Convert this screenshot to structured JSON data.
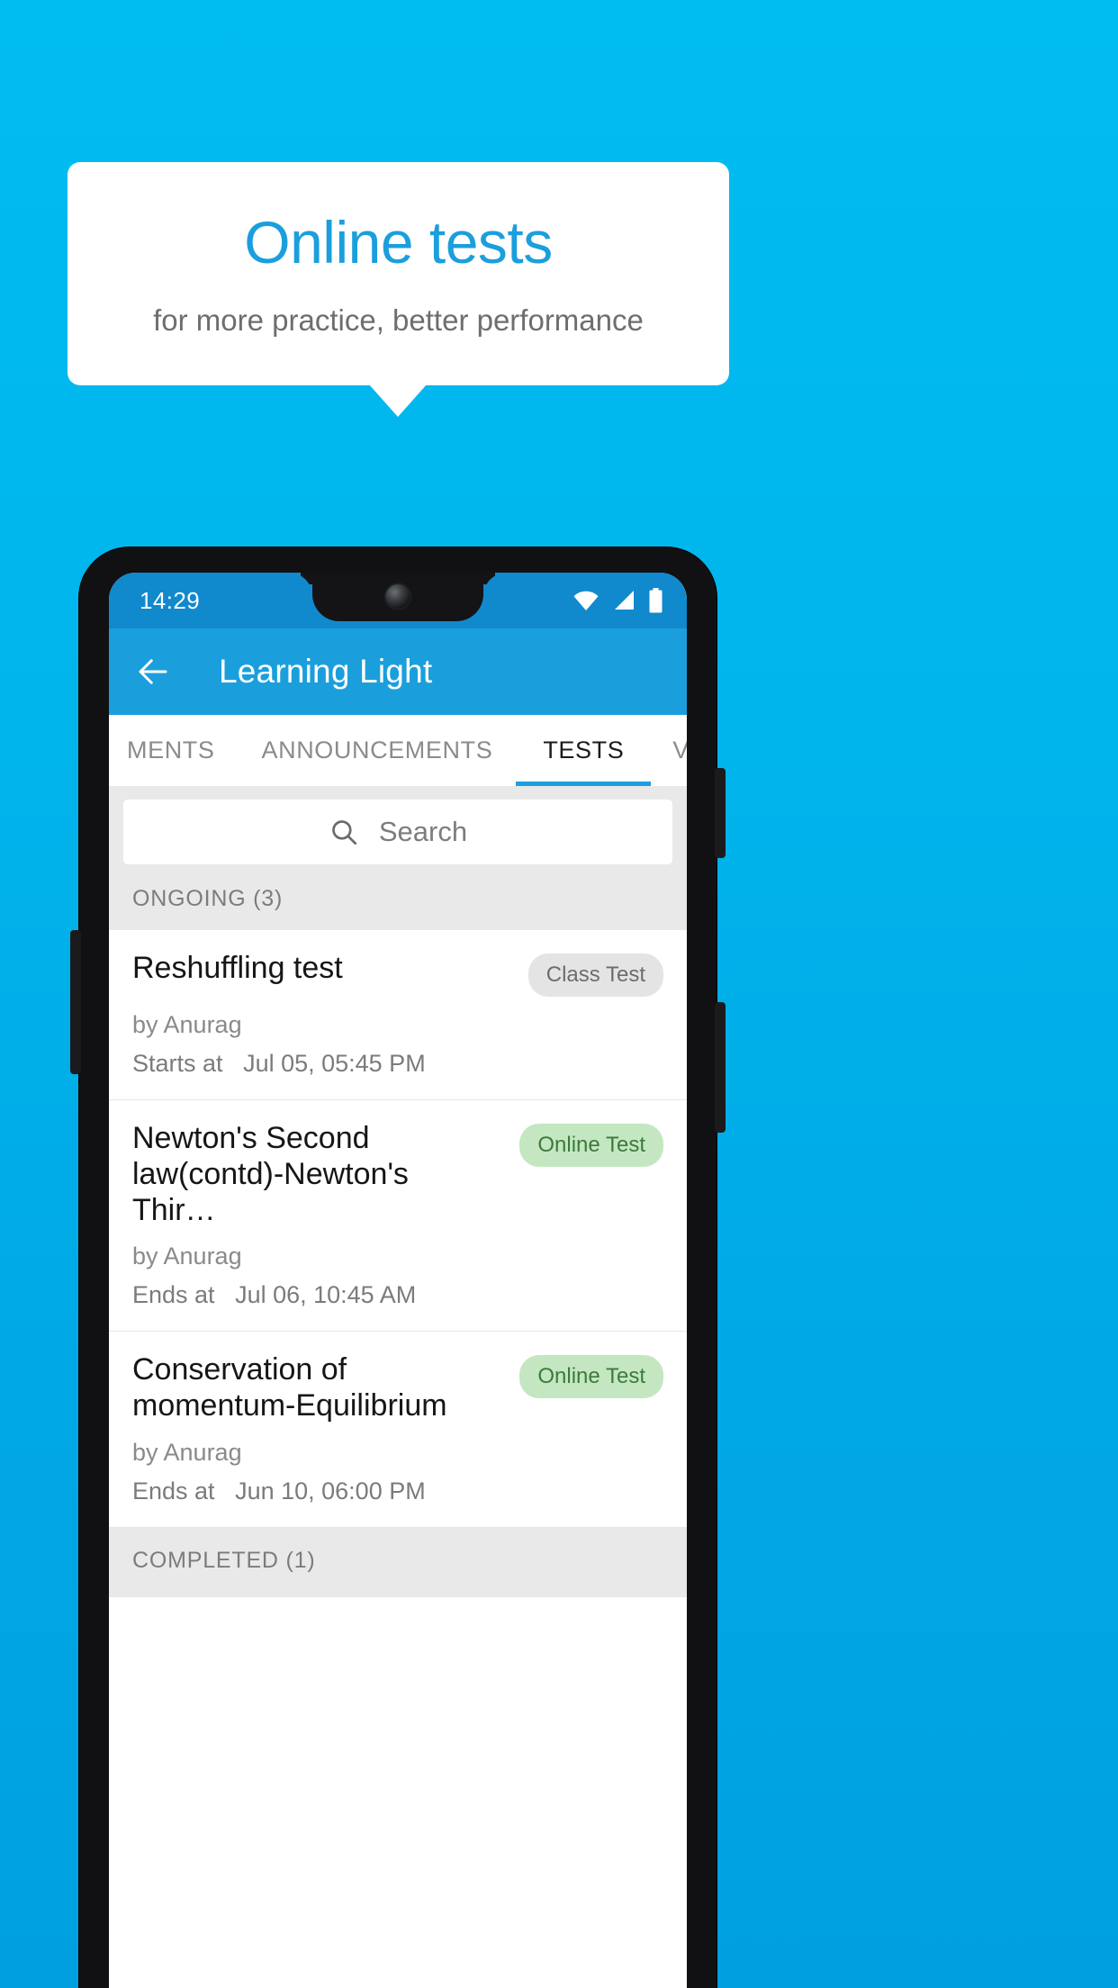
{
  "promo": {
    "title": "Online tests",
    "subtitle": "for more practice, better performance"
  },
  "phone": {
    "status_bar": {
      "clock": "14:29",
      "icons": [
        "wifi-icon",
        "signal-icon",
        "battery-icon"
      ]
    },
    "app_bar": {
      "back_icon": "back-arrow-icon",
      "title": "Learning Light"
    },
    "tabs": [
      {
        "label": "MENTS",
        "active": false
      },
      {
        "label": "ANNOUNCEMENTS",
        "active": false
      },
      {
        "label": "TESTS",
        "active": true
      },
      {
        "label": "VIDEOS",
        "active": false
      }
    ],
    "search": {
      "icon": "search-icon",
      "placeholder": "Search",
      "value": ""
    },
    "sections": [
      {
        "header": "ONGOING (3)",
        "items": [
          {
            "title": "Reshuffling test",
            "badge": "Class Test",
            "badge_type": "class",
            "author": "by Anurag",
            "time_label": "Starts at",
            "time_value": "Jul 05, 05:45 PM"
          },
          {
            "title": "Newton's Second law(contd)-Newton's Thir…",
            "badge": "Online Test",
            "badge_type": "online",
            "author": "by Anurag",
            "time_label": "Ends at",
            "time_value": "Jul 06, 10:45 AM"
          },
          {
            "title": "Conservation of momentum-Equilibrium",
            "badge": "Online Test",
            "badge_type": "online",
            "author": "by Anurag",
            "time_label": "Ends at",
            "time_value": "Jun 10, 06:00 PM"
          }
        ]
      },
      {
        "header": "COMPLETED (1)",
        "items": []
      }
    ]
  },
  "colors": {
    "brand_blue": "#1b9fdc",
    "background_blue": "#00b5ec",
    "status_bar_blue": "#1189cd",
    "badge_class_bg": "#e4e4e4",
    "badge_online_bg": "#c4e7c1",
    "badge_online_text": "#3d7a3a"
  }
}
